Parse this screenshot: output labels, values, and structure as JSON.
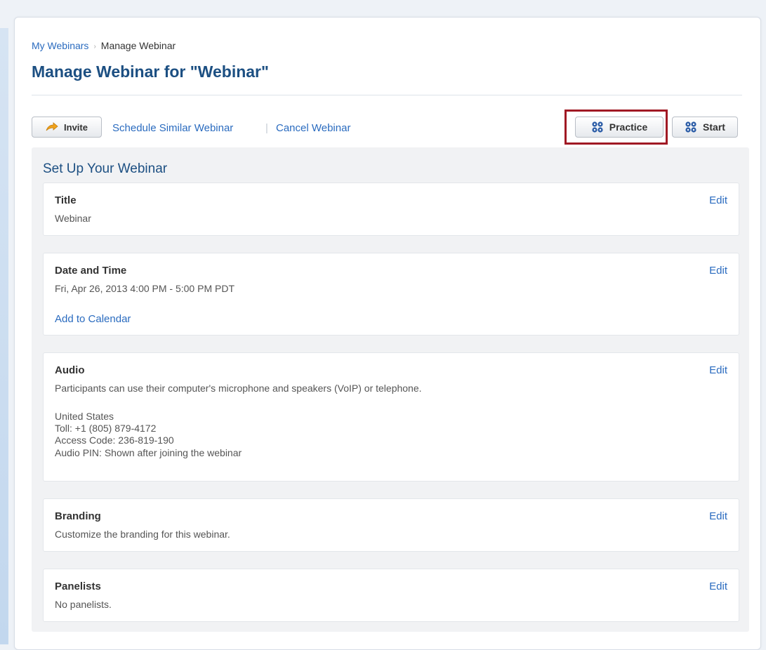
{
  "breadcrumb": {
    "parent": "My Webinars",
    "separator": "›",
    "current": "Manage Webinar"
  },
  "page_title": "Manage Webinar for \"Webinar\"",
  "toolbar": {
    "invite_label": "Invite",
    "invite_icon": "arrow-icon",
    "schedule_similar_label": "Schedule Similar Webinar",
    "separator": "|",
    "cancel_label": "Cancel Webinar",
    "practice_label": "Practice",
    "start_label": "Start",
    "practice_icon": "gear-cluster-icon",
    "start_icon": "gear-cluster-icon"
  },
  "setup": {
    "heading": "Set Up Your Webinar",
    "edit_label": "Edit",
    "title_section": {
      "label": "Title",
      "value": "Webinar"
    },
    "date_section": {
      "label": "Date and Time",
      "value": "Fri, Apr 26, 2013 4:00 PM - 5:00 PM PDT",
      "add_to_calendar": "Add to Calendar"
    },
    "audio_section": {
      "label": "Audio",
      "description": "Participants can use their computer's microphone and speakers (VoIP) or telephone.",
      "country": "United States",
      "toll": "Toll: +1 (805) 879-4172",
      "access_code": "Access Code: 236-819-190",
      "audio_pin": "Audio PIN: Shown after joining the webinar"
    },
    "branding_section": {
      "label": "Branding",
      "description": "Customize the branding for this webinar."
    },
    "panelists_section": {
      "label": "Panelists",
      "description": "No panelists."
    }
  },
  "colors": {
    "link": "#2a6bbf",
    "title": "#1c4f82",
    "highlight_border": "#a01924",
    "invite_arrow": "#f0a21c",
    "gear_icon": "#2f5fa8"
  }
}
